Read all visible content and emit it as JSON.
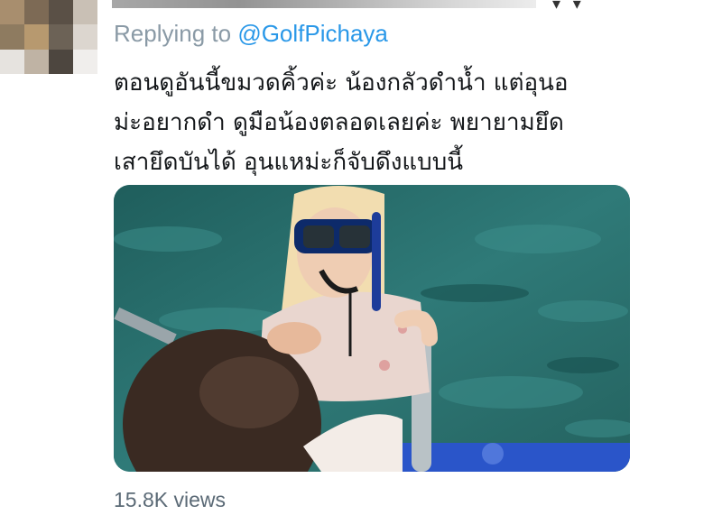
{
  "tweet": {
    "replying_prefix": "Replying to ",
    "replying_handle": "@GolfPichaya",
    "text_lines": [
      "ตอนดูอันนี้ขมวดคิ้วค่ะ น้องกลัวดำน้ำ แต่อุนอ",
      "ม่ะอยากดำ ดูมือน้องตลอดเลยค่ะ พยายามยึด",
      "เสายึดบันได้ อุนแหม่ะก็จับดึงแบบนี้"
    ],
    "views": "15.8K views"
  },
  "media": {
    "type": "video-thumbnail",
    "scene": "snorkeler-in-water-at-boat-ladder"
  },
  "colors": {
    "link": "#2a98e8",
    "muted": "#8a9aa6",
    "text": "#14171a"
  }
}
